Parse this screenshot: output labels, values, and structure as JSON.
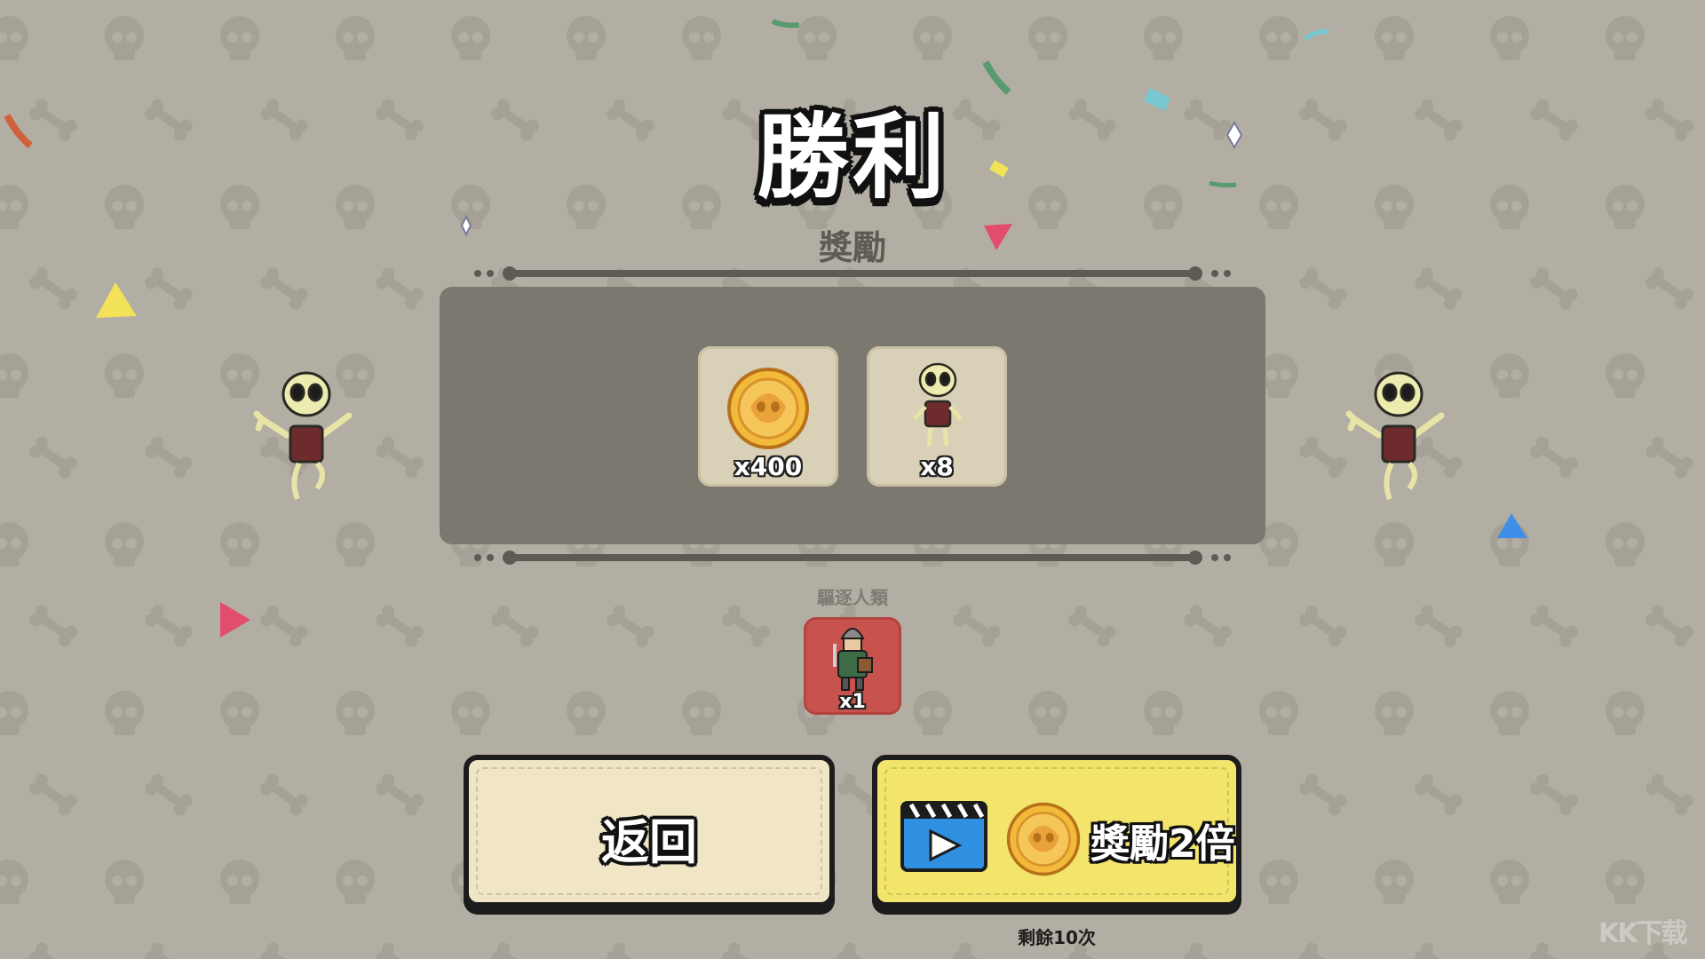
{
  "title": "勝利",
  "rewards": {
    "heading": "獎勵",
    "items": [
      {
        "icon": "gold-coin-icon",
        "count": "x400"
      },
      {
        "icon": "skeleton-icon",
        "count": "x8"
      }
    ]
  },
  "expel": {
    "label": "驅逐人類",
    "item": {
      "icon": "human-knight-icon",
      "count": "x1"
    }
  },
  "buttons": {
    "back_label": "返回",
    "double_label": "獎勵2倍",
    "double_icons": [
      "video-ad-icon",
      "gold-coin-icon"
    ],
    "remaining_label": "剩餘10次"
  },
  "watermark": "KK下载",
  "colors": {
    "background": "#b3aea3",
    "panel": "#7b7870",
    "tile": "#d9d0b8",
    "human_tile": "#c8524e",
    "back_button": "#f0e6c6",
    "double_button": "#f3e56c",
    "coin": "#f2b93b"
  }
}
